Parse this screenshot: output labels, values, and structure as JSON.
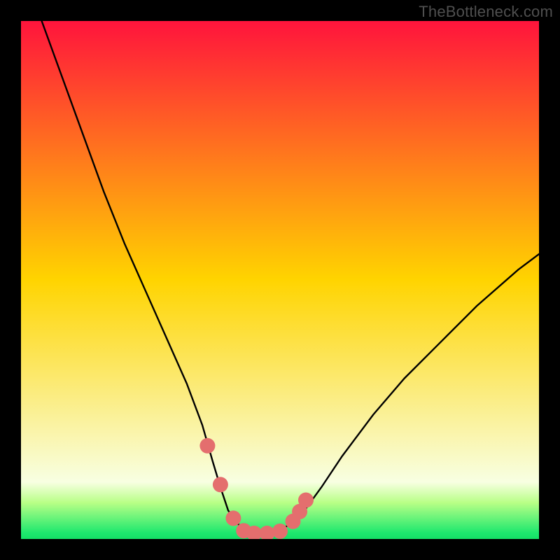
{
  "watermark": "TheBottleneck.com",
  "colors": {
    "frame": "#000000",
    "gradient_top": "#ff143c",
    "gradient_mid": "#ffd400",
    "gradient_bottom_green": "#1ee86e",
    "gradient_pale_band": "#f8ffe2",
    "curve_stroke": "#000000",
    "marker_fill": "#e46e6e"
  },
  "chart_data": {
    "type": "line",
    "title": "",
    "xlabel": "",
    "ylabel": "",
    "xlim": [
      0,
      100
    ],
    "ylim": [
      0,
      100
    ],
    "series": [
      {
        "name": "bottleneck-curve",
        "x": [
          4,
          8,
          12,
          16,
          20,
          24,
          28,
          32,
          35,
          37,
          38.5,
          40,
          42,
          44,
          46,
          48,
          50,
          54,
          58,
          62,
          68,
          74,
          80,
          88,
          96,
          100
        ],
        "values": [
          100,
          89,
          78,
          67,
          57,
          48,
          39,
          30,
          22,
          15,
          10,
          5.5,
          2.8,
          1.4,
          1.1,
          1.1,
          1.5,
          4.5,
          10,
          16,
          24,
          31,
          37,
          45,
          52,
          55
        ]
      }
    ],
    "markers": {
      "name": "highlighted-points",
      "x": [
        36,
        38.5,
        41,
        43,
        45,
        47.5,
        50,
        52.5,
        53.8,
        55
      ],
      "values": [
        18,
        10.5,
        4,
        1.6,
        1.1,
        1.1,
        1.5,
        3.4,
        5.3,
        7.5
      ]
    },
    "gradient_bands": [
      {
        "at_y": 100,
        "color": "#ff143c"
      },
      {
        "at_y": 50,
        "color": "#ffd400"
      },
      {
        "at_y": 11,
        "color": "#f8ffe2"
      },
      {
        "at_y": 7,
        "color": "#b8ff86"
      },
      {
        "at_y": 1.2,
        "color": "#1ee86e"
      },
      {
        "at_y": 0,
        "color": "#14e066"
      }
    ]
  }
}
